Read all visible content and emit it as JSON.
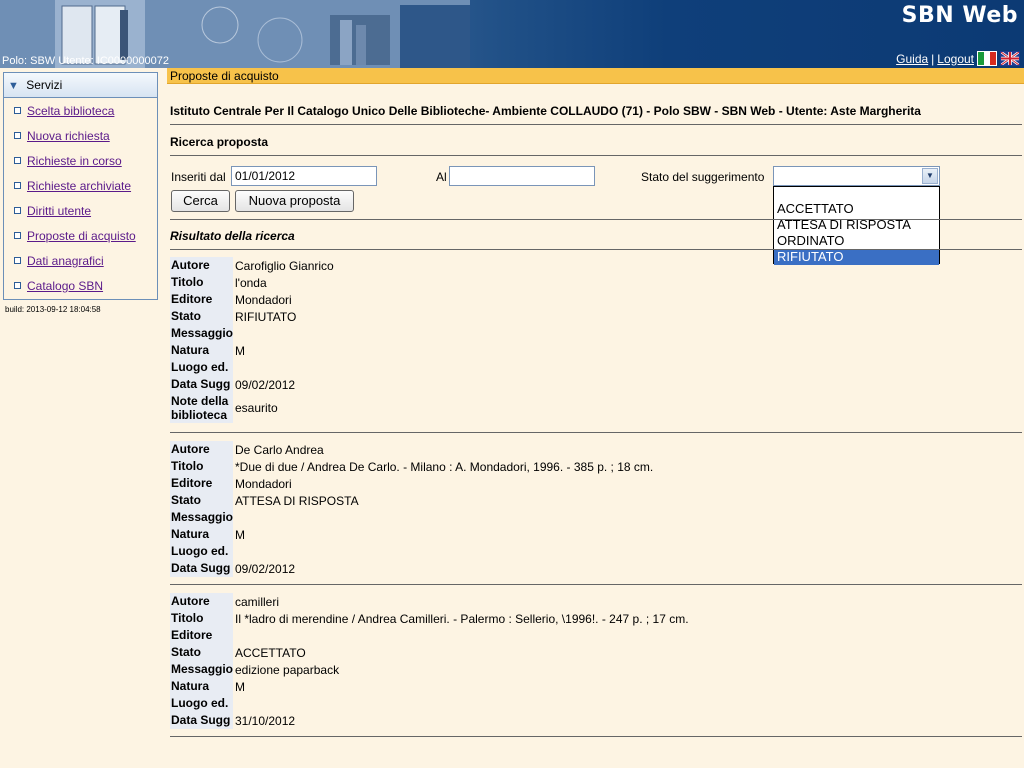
{
  "header": {
    "app_title": "SBN Web",
    "polo_info": "Polo: SBW  Utente: IC0000000072",
    "link_guida": "Guida",
    "separator": "|",
    "link_logout": "Logout"
  },
  "sidebar": {
    "title": "Servizi",
    "items": [
      {
        "label": "Scelta biblioteca"
      },
      {
        "label": "Nuova richiesta"
      },
      {
        "label": "Richieste in corso"
      },
      {
        "label": "Richieste archiviate"
      },
      {
        "label": "Diritti utente"
      },
      {
        "label": "Proposte di acquisto"
      },
      {
        "label": "Dati anagrafici"
      },
      {
        "label": "Catalogo SBN"
      }
    ],
    "build": "build: 2013-09-12 18:04:58"
  },
  "main": {
    "page_title": "Proposte di acquisto",
    "context": "Istituto Centrale Per Il Catalogo Unico Delle Biblioteche- Ambiente COLLAUDO (71) - Polo SBW - SBN Web - Utente: Aste Margherita",
    "search_title": "Ricerca proposta",
    "from_label": "Inseriti dal",
    "from_value": "01/01/2012",
    "to_label": "Al",
    "to_value": "",
    "status_label": "Stato del suggerimento",
    "status_value": "",
    "status_options": [
      "ACCETTATO",
      "ATTESA DI RISPOSTA",
      "ORDINATO",
      "RIFIUTATO"
    ],
    "search_button": "Cerca",
    "new_button": "Nuova proposta",
    "results_title": "Risultato della ricerca"
  },
  "field_labels": {
    "autore": "Autore",
    "titolo": "Titolo",
    "editore": "Editore",
    "stato": "Stato",
    "messaggio": "Messaggio",
    "natura": "Natura",
    "luogo": "Luogo ed.",
    "data": "Data Sugg",
    "note_1": "Note della",
    "note_2": "biblioteca"
  },
  "results": [
    {
      "autore": "Carofiglio Gianrico",
      "titolo": "l'onda",
      "editore": "Mondadori",
      "stato": "RIFIUTATO",
      "messaggio": "",
      "natura": "M",
      "luogo": "",
      "data": "09/02/2012",
      "note": "esaurito"
    },
    {
      "autore": "De Carlo Andrea",
      "titolo": "*Due di due / Andrea De Carlo. - Milano : A. Mondadori, 1996. - 385 p. ; 18 cm.",
      "editore": "Mondadori",
      "stato": "ATTESA DI RISPOSTA",
      "messaggio": "",
      "natura": "M",
      "luogo": "",
      "data": "09/02/2012"
    },
    {
      "autore": "camilleri",
      "titolo": "Il *ladro di merendine / Andrea Camilleri. - Palermo : Sellerio, \\1996!. - 247 p. ; 17 cm.",
      "editore": "",
      "stato": "ACCETTATO",
      "messaggio": "edizione paparback",
      "natura": "M",
      "luogo": "",
      "data": "31/10/2012"
    }
  ]
}
